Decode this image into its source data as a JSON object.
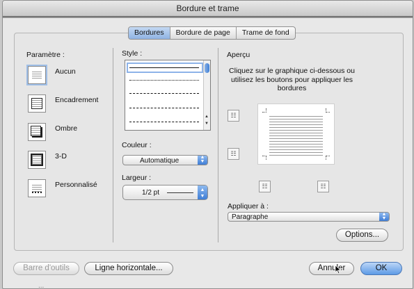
{
  "dialog": {
    "title": "Bordure et trame",
    "tabs": [
      "Bordures",
      "Bordure de page",
      "Trame de fond"
    ],
    "active_tab": "Bordures"
  },
  "setting": {
    "label": "Paramètre :",
    "items": [
      "Aucun",
      "Encadrement",
      "Ombre",
      "3-D",
      "Personnalisé"
    ],
    "selected": "Aucun"
  },
  "style": {
    "label": "Style :",
    "items": [
      "solid",
      "dotted",
      "dashed-small",
      "dashed",
      "dash-dot"
    ],
    "selected": "solid"
  },
  "color": {
    "label": "Couleur :",
    "value": "Automatique"
  },
  "width": {
    "label": "Largeur :",
    "value": "1/2 pt"
  },
  "preview": {
    "label": "Aperçu",
    "instructions": "Cliquez sur le graphique ci-dessous ou utilisez les boutons pour appliquer les bordures"
  },
  "apply_to": {
    "label": "Appliquer à :",
    "value": "Paragraphe"
  },
  "buttons": {
    "options": "Options...",
    "toolbar": "Barre d'outils",
    "horizontal_line": "Ligne horizontale...",
    "cancel": "Annuler",
    "ok": "OK"
  },
  "background_text": "...",
  "colors": {
    "accent": "#3f7ed6",
    "selected_tab": "#a9c6ee"
  }
}
